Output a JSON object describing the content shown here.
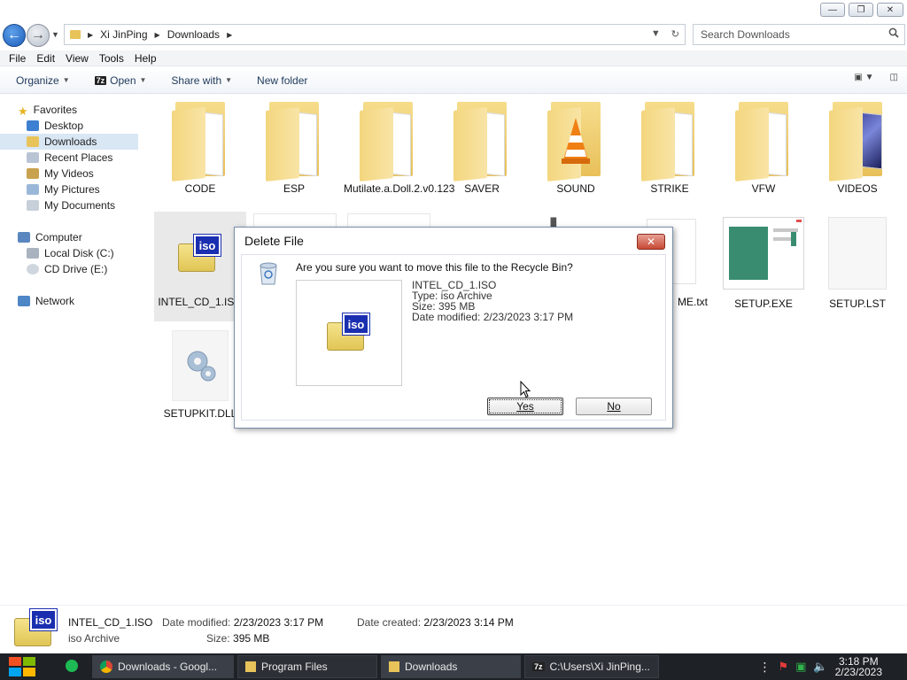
{
  "window": {
    "controls": {
      "minimize": "—",
      "maximize": "❐",
      "close": "✕"
    }
  },
  "address": {
    "crumbs": [
      "Xi JinPing",
      "Downloads"
    ],
    "search_placeholder": "Search Downloads"
  },
  "menu": [
    "File",
    "Edit",
    "View",
    "Tools",
    "Help"
  ],
  "toolbar": {
    "organize": "Organize",
    "open": "Open",
    "open_badge": "7z",
    "share": "Share with",
    "new_folder": "New folder"
  },
  "nav": {
    "favorites": "Favorites",
    "favorites_items": [
      "Desktop",
      "Downloads",
      "Recent Places",
      "My Videos",
      "My Pictures",
      "My Documents"
    ],
    "computer": "Computer",
    "computer_items": [
      "Local Disk (C:)",
      "CD Drive (E:)"
    ],
    "network": "Network"
  },
  "files": {
    "row1": [
      "CODE",
      "ESP",
      "Mutilate.a.Doll.2.v0.123",
      "SAVER",
      "SOUND",
      "STRIKE",
      "VFW",
      "VIDEOS"
    ],
    "row2_visible": [
      "INTEL_CD_1.ISO",
      "ME.txt",
      "SETUP.EXE",
      "SETUP.LST"
    ],
    "row3": [
      "SETUPKIT.DLL"
    ],
    "iso_label": "iso"
  },
  "dialog": {
    "title": "Delete File",
    "close": "✕",
    "question": "Are you sure you want to move this file to the Recycle Bin?",
    "file_name": "INTEL_CD_1.ISO",
    "type_line": "Type: iso Archive",
    "size_line": "Size: 395 MB",
    "modified_line": "Date modified: 2/23/2023 3:17 PM",
    "yes": "Yes",
    "no": "No"
  },
  "details": {
    "name": "INTEL_CD_1.ISO",
    "type": "iso Archive",
    "modified_label": "Date modified:",
    "modified": "2/23/2023 3:17 PM",
    "created_label": "Date created:",
    "created": "2/23/2023 3:14 PM",
    "size_label": "Size:",
    "size": "395 MB"
  },
  "taskbar": {
    "apps": [
      "Downloads - Googl...",
      "Program Files",
      "Downloads",
      "C:\\Users\\Xi JinPing..."
    ],
    "time": "3:18 PM",
    "date": "2/23/2023"
  },
  "colors": {
    "accent": "#1c5dba",
    "selection": "#d9e6f4",
    "iso_blue": "#1a2fb0",
    "taskbar": "#1e2126"
  }
}
